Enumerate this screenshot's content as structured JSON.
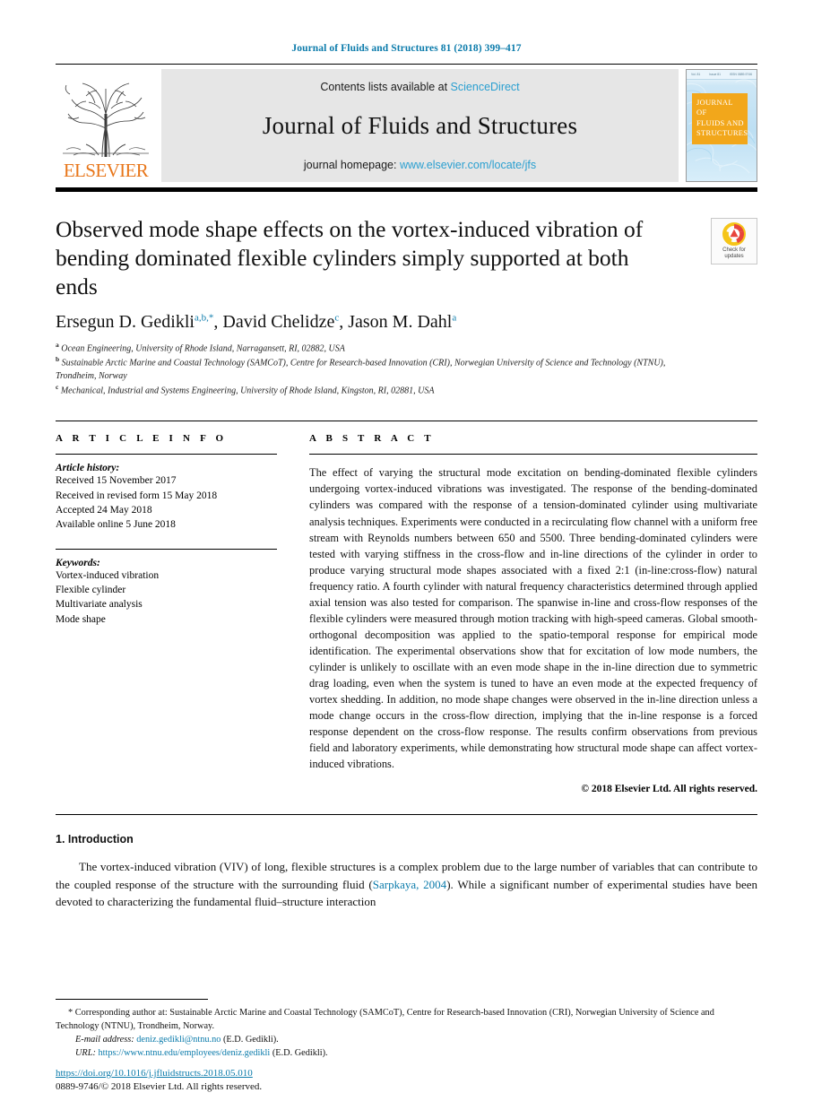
{
  "running_head": "Journal of Fluids and Structures 81 (2018) 399–417",
  "masthead": {
    "publisher_wordmark": "ELSEVIER",
    "contents_prefix": "Contents lists available at ",
    "contents_link": "ScienceDirect",
    "journal_name": "Journal of Fluids and Structures",
    "homepage_prefix": "journal homepage: ",
    "homepage_link": "www.elsevier.com/locate/jfs",
    "cover": {
      "title_line1": "JOURNAL OF",
      "title_line2": "FLUIDS AND",
      "title_line3": "STRUCTURES",
      "top_left": "Vol. 81",
      "top_mid": "Issue 81",
      "top_right": "ISSN 0889-9746",
      "bg_color": "#bddff3",
      "title_box_color": "#f2a71b"
    },
    "accent_link_color": "#2a9fd0",
    "logo_color": "#e8761a"
  },
  "article": {
    "title": "Observed mode shape effects on the vortex-induced vibration of bending dominated flexible cylinders simply supported at both ends",
    "crossmark_label_line1": "Check for",
    "crossmark_label_line2": "updates",
    "authors": [
      {
        "name": "Ersegun D. Gedikli",
        "marks": "a,b,*"
      },
      {
        "name": "David Chelidze",
        "marks": "c"
      },
      {
        "name": "Jason M. Dahl",
        "marks": "a"
      }
    ],
    "affiliations": [
      {
        "mark": "a",
        "text": "Ocean Engineering, University of Rhode Island, Narragansett, RI, 02882, USA"
      },
      {
        "mark": "b",
        "text": "Sustainable Arctic Marine and Coastal Technology (SAMCoT), Centre for Research-based Innovation (CRI), Norwegian University of Science and Technology (NTNU), Trondheim, Norway"
      },
      {
        "mark": "c",
        "text": "Mechanical, Industrial and Systems Engineering, University of Rhode Island, Kingston, RI, 02881, USA"
      }
    ]
  },
  "info": {
    "heading": "A R T I C L E  I N F O",
    "history_label": "Article history:",
    "history": [
      "Received 15 November 2017",
      "Received in revised form 15 May 2018",
      "Accepted 24 May 2018",
      "Available online 5 June 2018"
    ],
    "keywords_label": "Keywords:",
    "keywords": [
      "Vortex-induced vibration",
      "Flexible cylinder",
      "Multivariate analysis",
      "Mode shape"
    ]
  },
  "abstract": {
    "heading": "A B S T R A C T",
    "text": "The effect of varying the structural mode excitation on bending-dominated flexible cylinders undergoing vortex-induced vibrations was investigated. The response of the bending-dominated cylinders was compared with the response of a tension-dominated cylinder using multivariate analysis techniques. Experiments were conducted in a recirculating flow channel with a uniform free stream with Reynolds numbers between 650 and 5500. Three bending-dominated cylinders were tested with varying stiffness in the cross-flow and in-line directions of the cylinder in order to produce varying structural mode shapes associated with a fixed 2:1 (in-line:cross-flow) natural frequency ratio. A fourth cylinder with natural frequency characteristics determined through applied axial tension was also tested for comparison. The spanwise in-line and cross-flow responses of the flexible cylinders were measured through motion tracking with high-speed cameras. Global smooth-orthogonal decomposition was applied to the spatio-temporal response for empirical mode identification. The experimental observations show that for excitation of low mode numbers, the cylinder is unlikely to oscillate with an even mode shape in the in-line direction due to symmetric drag loading, even when the system is tuned to have an even mode at the expected frequency of vortex shedding. In addition, no mode shape changes were observed in the in-line direction unless a mode change occurs in the cross-flow direction, implying that the in-line response is a forced response dependent on the cross-flow response. The results confirm observations from previous field and laboratory experiments, while demonstrating how structural mode shape can affect vortex-induced vibrations.",
    "copyright": "© 2018 Elsevier Ltd. All rights reserved."
  },
  "body": {
    "section_number_title": "1. Introduction",
    "paragraph_part1": "The vortex-induced vibration (VIV) of long, flexible structures is a complex problem due to the large number of variables that can contribute to the coupled response of the structure with the surrounding fluid (",
    "citation": "Sarpkaya, 2004",
    "paragraph_part2": "). While a significant number of experimental studies have been devoted to characterizing the fundamental fluid–structure interaction"
  },
  "footnotes": {
    "star": "*",
    "corresponding": "Corresponding author at: Sustainable Arctic Marine and Coastal Technology (SAMCoT), Centre for Research-based Innovation (CRI), Norwegian University of Science and Technology (NTNU), Trondheim, Norway.",
    "email_label": "E-mail address:",
    "email_link": "deniz.gedikli@ntnu.no",
    "email_suffix": "(E.D. Gedikli).",
    "url_label": "URL:",
    "url_link": "https://www.ntnu.edu/employees/deniz.gedikli",
    "url_suffix": "(E.D. Gedikli)."
  },
  "footer": {
    "doi": "https://doi.org/10.1016/j.jfluidstructs.2018.05.010",
    "issn": "0889-9746/© 2018 Elsevier Ltd. All rights reserved."
  }
}
